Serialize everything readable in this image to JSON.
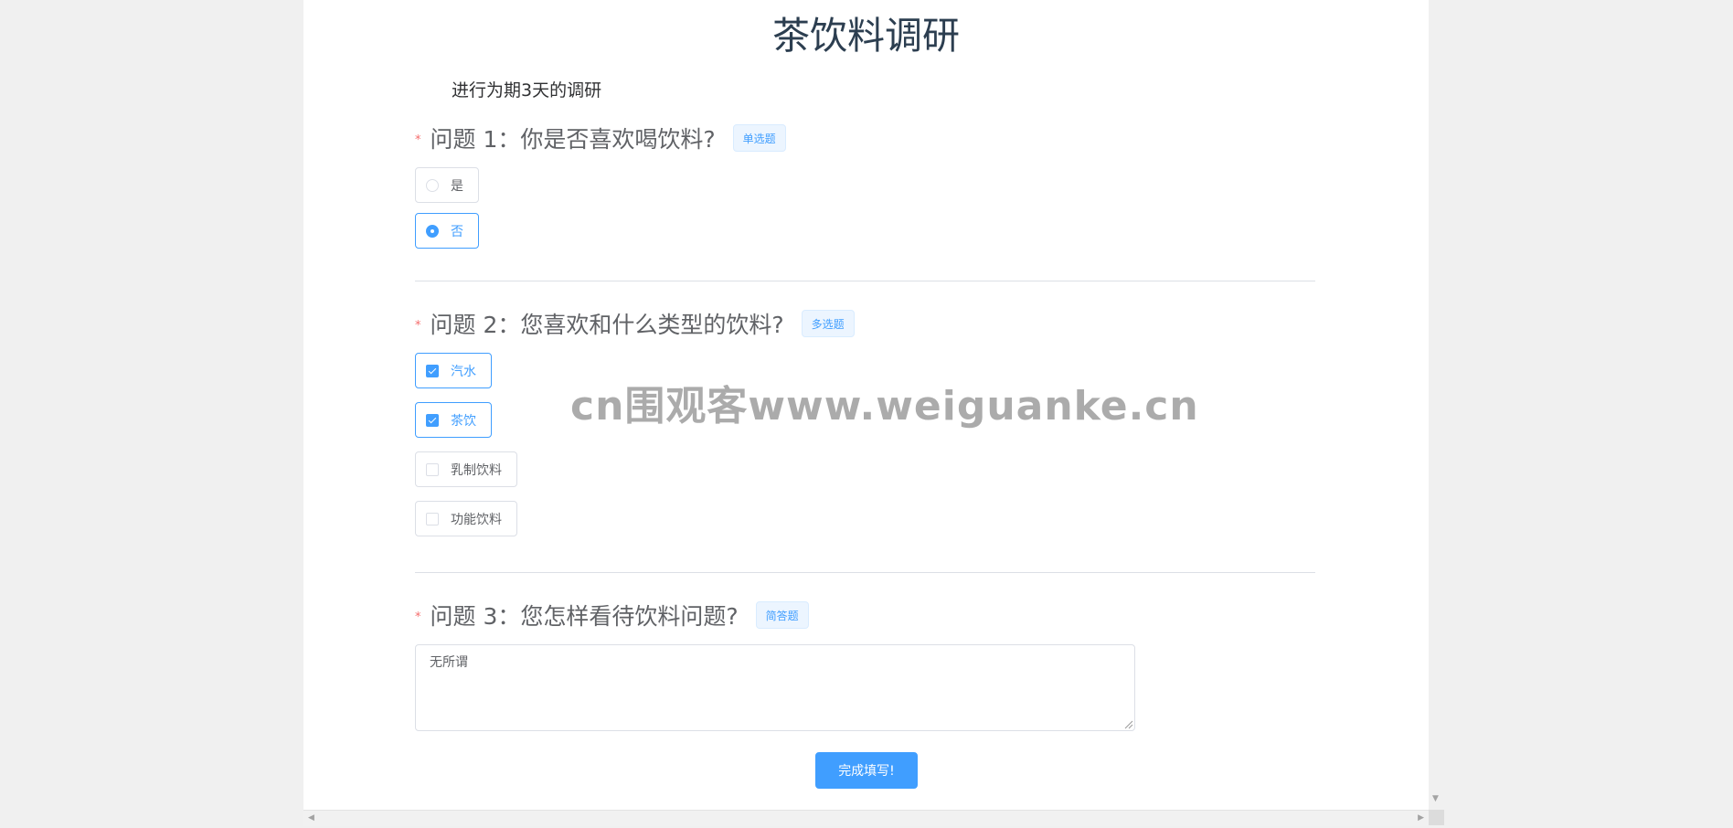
{
  "survey": {
    "title": "茶饮料调研",
    "description": "进行为期3天的调研",
    "required_mark": "*"
  },
  "questions": [
    {
      "label": "问题 1：你是否喜欢喝饮料?",
      "tag": "单选题",
      "type": "radio",
      "options": [
        {
          "label": "是",
          "selected": false
        },
        {
          "label": "否",
          "selected": true
        }
      ]
    },
    {
      "label": "问题 2：您喜欢和什么类型的饮料?",
      "tag": "多选题",
      "type": "checkbox",
      "options": [
        {
          "label": "汽水",
          "selected": true
        },
        {
          "label": "茶饮",
          "selected": true
        },
        {
          "label": "乳制饮料",
          "selected": false
        },
        {
          "label": "功能饮料",
          "selected": false
        }
      ]
    },
    {
      "label": "问题 3：您怎样看待饮料问题?",
      "tag": "简答题",
      "type": "text",
      "value": "无所谓"
    }
  ],
  "submit_label": "完成填写!",
  "watermark": "cn围观客www.weiguanke.cn",
  "colors": {
    "accent": "#409eff",
    "required": "#f56c6c",
    "border": "#dcdfe6",
    "page_bg": "#f0f0f0"
  }
}
